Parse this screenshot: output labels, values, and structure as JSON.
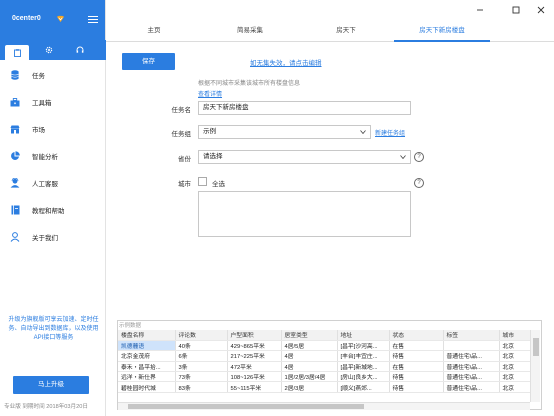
{
  "app": {
    "title": "0center0",
    "accent": "#2b7de0"
  },
  "sidebar": {
    "tabs": [
      {
        "icon": "clipboard-icon"
      },
      {
        "icon": "gear-icon"
      },
      {
        "icon": "headset-icon"
      }
    ],
    "items": [
      {
        "label": "任务",
        "icon": "database-icon"
      },
      {
        "label": "工具箱",
        "icon": "toolbox-icon"
      },
      {
        "label": "市场",
        "icon": "store-icon"
      },
      {
        "label": "智能分析",
        "icon": "pie-chart-icon"
      },
      {
        "label": "人工客服",
        "icon": "service-icon"
      },
      {
        "label": "教程和帮助",
        "icon": "book-icon"
      },
      {
        "label": "关于我们",
        "icon": "user-icon"
      }
    ],
    "promo": "升级为旗舰版可享云加速、定时任务、自动导出到数据库，以及使用API接口等服务",
    "upgrade_label": "马上升级",
    "footer": "专业版  到期时间 2018年03月20日"
  },
  "tabs": [
    "主页",
    "简易采集",
    "房天下",
    "房天下新房楼盘"
  ],
  "active_tab": 3,
  "toolbar": {
    "save_label": "保存",
    "help_link": "如无集失效，请点击编辑"
  },
  "form": {
    "hint": "根据不同城市采集该城市所有楼盘信息",
    "detail_link": "查看详情",
    "task_name_label": "任务名",
    "task_name_value": "房天下新房楼盘",
    "task_group_label": "任务组",
    "task_group_value": "示例",
    "new_group_link": "新建任务组",
    "province_label": "省份",
    "province_value": "请选择",
    "city_label": "城市",
    "select_all_label": "全选",
    "help_mark": "?"
  },
  "example": {
    "caption": "示例数据",
    "columns": [
      "楼盘名称",
      "评论数",
      "户型面积",
      "居室类型",
      "地址",
      "状态",
      "标签",
      "城市"
    ],
    "rows": [
      [
        "凯德麓语",
        "40条",
        "429~865平米",
        "4居/5居",
        "[昌平]沙河高...",
        "在售",
        "",
        "北京"
      ],
      [
        "北京金茂府",
        "6条",
        "217~225平米",
        "4居",
        "[丰台]丰宜庄...",
        "待售",
        "普通住宅\\品...",
        "北京"
      ],
      [
        "泰禾・昌平拾...",
        "3条",
        "472平米",
        "4居",
        "[昌平]新城地...",
        "在售",
        "普通住宅\\品...",
        "北京"
      ],
      [
        "远洋・新仕界",
        "73条",
        "108~126平米",
        "1居/2居/3居/4居",
        "[房山]良乡大...",
        "待售",
        "普通住宅\\品...",
        "北京"
      ],
      [
        "碧桂园时代城",
        "83条",
        "55~115平米",
        "2居/3居",
        "[顺义]燕郊...",
        "待售",
        "普通住宅\\品...",
        "北京"
      ],
      [
        "",
        "",
        "",
        "",
        "",
        "",
        "",
        ""
      ]
    ]
  }
}
